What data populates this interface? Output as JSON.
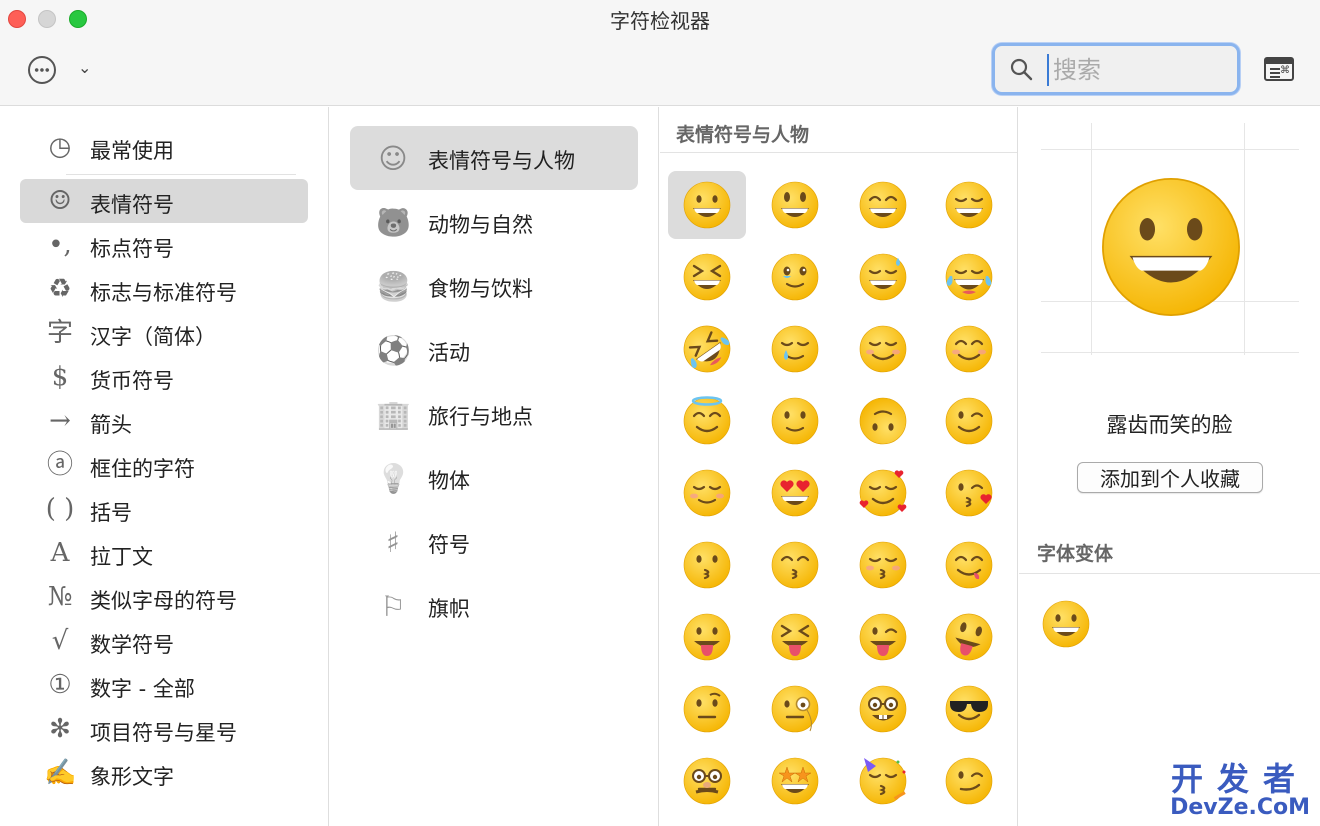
{
  "window": {
    "title": "字符检视器"
  },
  "search": {
    "placeholder": "搜索",
    "value": ""
  },
  "sidebar": {
    "items": [
      {
        "label": "最常使用",
        "icon": "clock-icon",
        "glyph": "◷",
        "selected": false
      },
      {
        "label": "表情符号",
        "icon": "smiley-icon",
        "glyph": "☺",
        "selected": true
      },
      {
        "label": "标点符号",
        "icon": "punctuation-icon",
        "glyph": "•,",
        "selected": false
      },
      {
        "label": "标志与标准符号",
        "icon": "recycle-icon",
        "glyph": "♻",
        "selected": false
      },
      {
        "label": "汉字（简体）",
        "icon": "hanzi-icon",
        "glyph": "字",
        "selected": false
      },
      {
        "label": "货币符号",
        "icon": "dollar-icon",
        "glyph": "$",
        "selected": false
      },
      {
        "label": "箭头",
        "icon": "arrow-icon",
        "glyph": "→",
        "selected": false
      },
      {
        "label": "框住的字符",
        "icon": "circled-a-icon",
        "glyph": "ⓐ",
        "selected": false
      },
      {
        "label": "括号",
        "icon": "parentheses-icon",
        "glyph": "( )",
        "selected": false
      },
      {
        "label": "拉丁文",
        "icon": "latin-a-icon",
        "glyph": "A",
        "selected": false
      },
      {
        "label": "类似字母的符号",
        "icon": "numero-icon",
        "glyph": "№",
        "selected": false
      },
      {
        "label": "数学符号",
        "icon": "sqrt-icon",
        "glyph": "√",
        "selected": false
      },
      {
        "label": "数字 - 全部",
        "icon": "circled-one-icon",
        "glyph": "①",
        "selected": false
      },
      {
        "label": "项目符号与星号",
        "icon": "asterisk-icon",
        "glyph": "✻",
        "selected": false
      },
      {
        "label": "象形文字",
        "icon": "pictograph-icon",
        "glyph": "✍",
        "selected": false
      }
    ]
  },
  "categories": [
    {
      "label": "表情符号与人物",
      "icon": "smiley-face-icon",
      "glyph": "☺",
      "selected": true
    },
    {
      "label": "动物与自然",
      "icon": "bear-icon",
      "glyph": "🐻",
      "selected": false
    },
    {
      "label": "食物与饮料",
      "icon": "burger-drink-icon",
      "glyph": "🍔",
      "selected": false
    },
    {
      "label": "活动",
      "icon": "soccer-ball-icon",
      "glyph": "⚽",
      "selected": false
    },
    {
      "label": "旅行与地点",
      "icon": "building-car-icon",
      "glyph": "🏢",
      "selected": false
    },
    {
      "label": "物体",
      "icon": "lightbulb-icon",
      "glyph": "💡",
      "selected": false
    },
    {
      "label": "符号",
      "icon": "symbols-icon",
      "glyph": "♯",
      "selected": false
    },
    {
      "label": "旗帜",
      "icon": "flag-icon",
      "glyph": "⚐",
      "selected": false
    }
  ],
  "grid": {
    "header": "表情符号与人物",
    "emojis": [
      "grinning-face",
      "grinning-big-eyes",
      "grinning-smiling-eyes",
      "beaming-face",
      "squinting-face",
      "face-holding-back-tears",
      "grinning-sweat",
      "tears-of-joy",
      "rolling-laughing",
      "smiling-tear",
      "smiling-face",
      "smiling-eyes",
      "smiling-halo",
      "slightly-smiling",
      "upside-down",
      "winking-face",
      "relieved-face",
      "heart-eyes",
      "smiling-hearts",
      "face-blowing-kiss",
      "kissing-face",
      "kissing-smiling-eyes",
      "kissing-closed-eyes",
      "face-savoring-food",
      "face-tongue",
      "squinting-tongue",
      "winking-tongue",
      "zany-face",
      "raised-eyebrow",
      "monocle-face",
      "nerd-face",
      "sunglasses-face",
      "disguised-face",
      "star-struck",
      "partying-face",
      "smirking-face"
    ]
  },
  "detail": {
    "name": "露齿而笑的脸",
    "favorite_label": "添加到个人收藏",
    "variants_title": "字体变体"
  },
  "watermark": {
    "line1": "开发者",
    "line2": "DevZe.CoM"
  },
  "colors": {
    "emoji_yellow": "#fcc21b",
    "emoji_dark": "#6b4a1a",
    "search_ring": "#8ab4ee",
    "selection": "#d9d9d9"
  }
}
